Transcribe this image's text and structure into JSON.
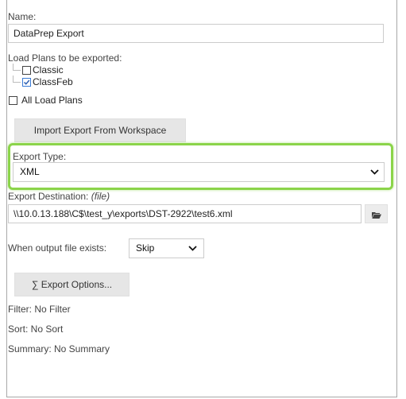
{
  "form": {
    "name_label": "Name:",
    "name_value": "DataPrep Export",
    "load_plans_label": "Load Plans to be exported:",
    "load_plans": [
      {
        "label": "Classic",
        "checked": false
      },
      {
        "label": "ClassFeb",
        "checked": true
      }
    ],
    "all_load_plans_label": "All Load Plans",
    "all_load_plans_checked": false,
    "import_button_label": "Import Export From Workspace",
    "export_type_label": "Export Type:",
    "export_type_value": "XML",
    "export_destination_label": "Export Destination:",
    "export_destination_hint": "(file)",
    "export_destination_value": "\\\\10.0.13.188\\C$\\test_y\\exports\\DST-2922\\test6.xml",
    "when_exists_label": "When output file exists:",
    "when_exists_value": "Skip",
    "export_options_button_label": "∑ Export Options...",
    "filter_text": "Filter: No Filter",
    "sort_text": "Sort: No Sort",
    "summary_text": "Summary: No Summary"
  },
  "colors": {
    "highlight": "#8bd44a",
    "checkbox_accent": "#3a7bd5",
    "button_bg": "#e6e6e6"
  },
  "icons": {
    "browse": "folder-open-icon",
    "dropdown": "chevron-down-icon",
    "checked": "checkmark-icon"
  }
}
